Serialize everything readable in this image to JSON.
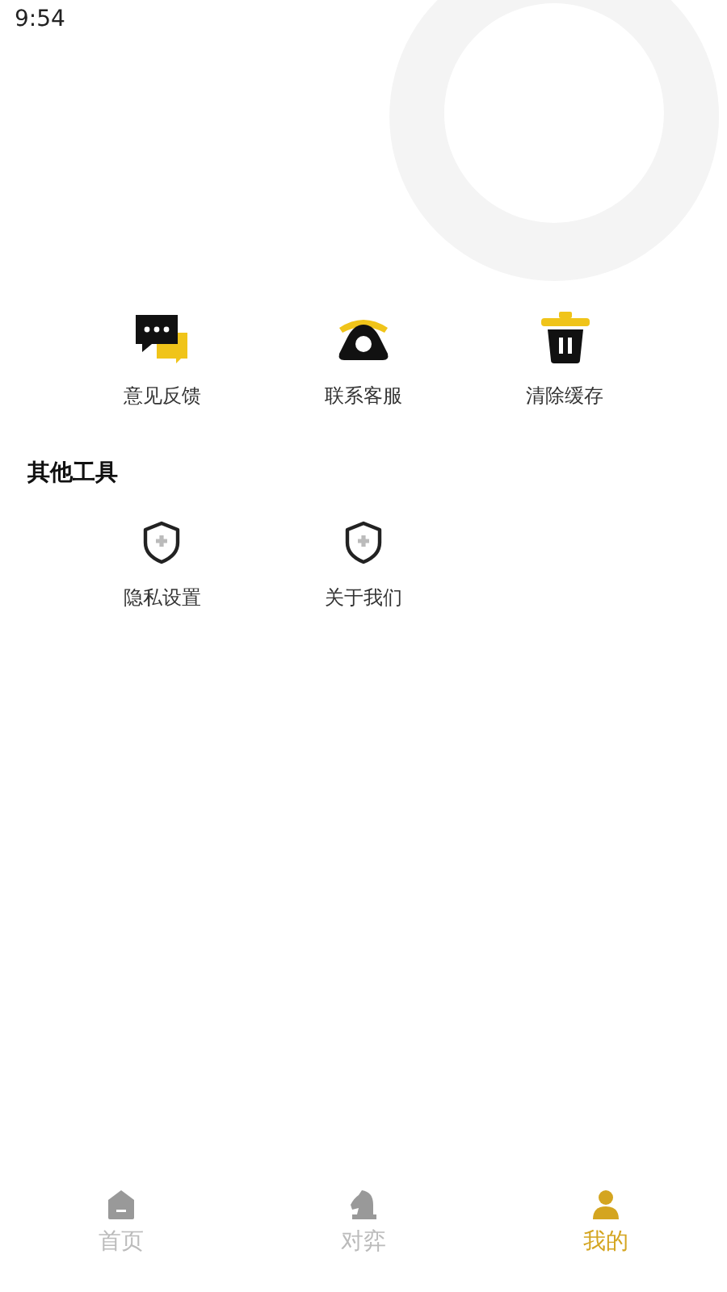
{
  "status_bar": {
    "time": "9:54"
  },
  "tools": [
    {
      "kind": "feedback",
      "label": "意见反馈"
    },
    {
      "kind": "phone",
      "label": "联系客服"
    },
    {
      "kind": "trash",
      "label": "清除缓存"
    }
  ],
  "other_section": {
    "title": "其他工具",
    "items": [
      {
        "kind": "shield",
        "label": "隐私设置"
      },
      {
        "kind": "shield",
        "label": "关于我们"
      }
    ]
  },
  "tab_bar": [
    {
      "kind": "home",
      "label": "首页",
      "selected": false
    },
    {
      "kind": "chess",
      "label": "对弈",
      "selected": false
    },
    {
      "kind": "user",
      "label": "我的",
      "selected": true
    }
  ]
}
